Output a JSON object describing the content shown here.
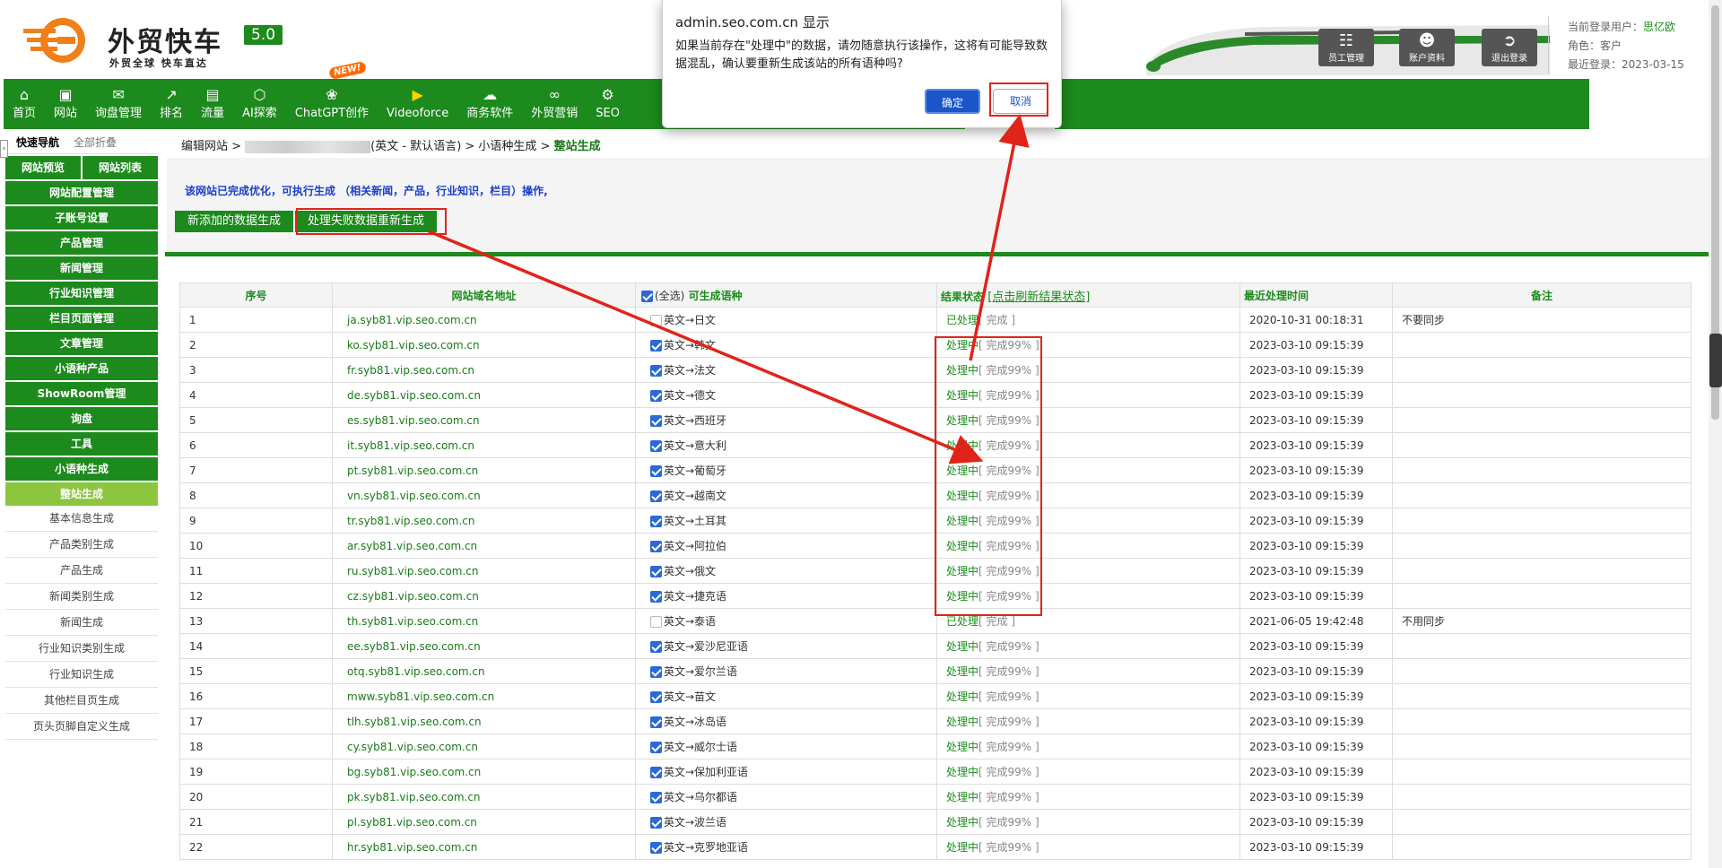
{
  "logo": {
    "name": "外贸快车",
    "version": "5.0",
    "slogan": "外贸全球 快车直达"
  },
  "header_buttons": [
    {
      "icon": "staff-icon",
      "label": "员工管理"
    },
    {
      "icon": "account-icon",
      "label": "账户资料"
    },
    {
      "icon": "logout-icon",
      "label": "退出登录"
    }
  ],
  "user_info": {
    "user_label": "当前登录用户：",
    "user": "思亿欧",
    "role_label": "角色：",
    "role": "客户",
    "last_login_label": "最近登录：",
    "last_login": "2023-03-15"
  },
  "nav": [
    {
      "icon": "home-icon",
      "label": "首页"
    },
    {
      "icon": "monitor-icon",
      "label": "网站"
    },
    {
      "icon": "mail-icon",
      "label": "询盘管理"
    },
    {
      "icon": "rank-icon",
      "label": "排名"
    },
    {
      "icon": "bar-chart-icon",
      "label": "流量"
    },
    {
      "icon": "ai-icon",
      "label": "AI探索"
    },
    {
      "icon": "chatgpt-icon",
      "label": "ChatGPT创作",
      "badge": "NEW!"
    },
    {
      "icon": "video-icon",
      "label": "Videoforce"
    },
    {
      "icon": "software-icon",
      "label": "商务软件"
    },
    {
      "icon": "marketing-icon",
      "label": "外贸营销"
    },
    {
      "icon": "seo-icon",
      "label": "SEO"
    }
  ],
  "sidebar": {
    "tab_quick": "快速导航",
    "tab_collapse": "全部折叠",
    "collapse_btn": "‹",
    "top_pair": [
      "网站预览",
      "网站列表"
    ],
    "groups": [
      "网站配置管理",
      "子账号设置",
      "产品管理",
      "新闻管理",
      "行业知识管理",
      "栏目页面管理",
      "文章管理",
      "小语种产品",
      "ShowRoom管理",
      "询盘",
      "工具",
      "小语种生成",
      "整站生成"
    ],
    "subitems": [
      "基本信息生成",
      "产品类别生成",
      "产品生成",
      "新闻类别生成",
      "新闻生成",
      "行业知识类别生成",
      "行业知识生成",
      "其他栏目页生成",
      "页头页脚自定义生成"
    ]
  },
  "breadcrumb": {
    "prefix": "编辑网站 >",
    "middle": "(英文 - 默认语言) > 小语种生成 >",
    "current": "整站生成"
  },
  "notice": "该网站已完成优化，可执行生成 （相关新闻，产品，行业知识，栏目）操作,",
  "gen_tabs": [
    "新添加的数据生成",
    "处理失败数据重新生成"
  ],
  "table": {
    "headers": {
      "no": "序号",
      "domain": "网站域名地址",
      "langs_all": "(全选)",
      "langs": "可生成语种",
      "status": "结果状态",
      "refresh": "[点击刷新结果状态]",
      "time": "最近处理时间",
      "note": "备注"
    },
    "rows": [
      {
        "no": "1",
        "domain": "ja.syb81.vip.seo.com.cn",
        "checked": false,
        "lang": "英文→日文",
        "state": "已处理",
        "progress": "[ 完成 ]",
        "time": "2020-10-31 00:18:31",
        "note": "不要同步"
      },
      {
        "no": "2",
        "domain": "ko.syb81.vip.seo.com.cn",
        "checked": true,
        "lang": "英文→韩文",
        "state": "处理中",
        "progress": "[ 完成99% ]",
        "time": "2023-03-10 09:15:39",
        "note": ""
      },
      {
        "no": "3",
        "domain": "fr.syb81.vip.seo.com.cn",
        "checked": true,
        "lang": "英文→法文",
        "state": "处理中",
        "progress": "[ 完成99% ]",
        "time": "2023-03-10 09:15:39",
        "note": ""
      },
      {
        "no": "4",
        "domain": "de.syb81.vip.seo.com.cn",
        "checked": true,
        "lang": "英文→德文",
        "state": "处理中",
        "progress": "[ 完成99% ]",
        "time": "2023-03-10 09:15:39",
        "note": ""
      },
      {
        "no": "5",
        "domain": "es.syb81.vip.seo.com.cn",
        "checked": true,
        "lang": "英文→西班牙",
        "state": "处理中",
        "progress": "[ 完成99% ]",
        "time": "2023-03-10 09:15:39",
        "note": ""
      },
      {
        "no": "6",
        "domain": "it.syb81.vip.seo.com.cn",
        "checked": true,
        "lang": "英文→意大利",
        "state": "处理中",
        "progress": "[ 完成99% ]",
        "time": "2023-03-10 09:15:39",
        "note": ""
      },
      {
        "no": "7",
        "domain": "pt.syb81.vip.seo.com.cn",
        "checked": true,
        "lang": "英文→葡萄牙",
        "state": "处理中",
        "progress": "[ 完成99% ]",
        "time": "2023-03-10 09:15:39",
        "note": ""
      },
      {
        "no": "8",
        "domain": "vn.syb81.vip.seo.com.cn",
        "checked": true,
        "lang": "英文→越南文",
        "state": "处理中",
        "progress": "[ 完成99% ]",
        "time": "2023-03-10 09:15:39",
        "note": ""
      },
      {
        "no": "9",
        "domain": "tr.syb81.vip.seo.com.cn",
        "checked": true,
        "lang": "英文→土耳其",
        "state": "处理中",
        "progress": "[ 完成99% ]",
        "time": "2023-03-10 09:15:39",
        "note": ""
      },
      {
        "no": "10",
        "domain": "ar.syb81.vip.seo.com.cn",
        "checked": true,
        "lang": "英文→阿拉伯",
        "state": "处理中",
        "progress": "[ 完成99% ]",
        "time": "2023-03-10 09:15:39",
        "note": ""
      },
      {
        "no": "11",
        "domain": "ru.syb81.vip.seo.com.cn",
        "checked": true,
        "lang": "英文→俄文",
        "state": "处理中",
        "progress": "[ 完成99% ]",
        "time": "2023-03-10 09:15:39",
        "note": ""
      },
      {
        "no": "12",
        "domain": "cz.syb81.vip.seo.com.cn",
        "checked": true,
        "lang": "英文→捷克语",
        "state": "处理中",
        "progress": "[ 完成99% ]",
        "time": "2023-03-10 09:15:39",
        "note": ""
      },
      {
        "no": "13",
        "domain": "th.syb81.vip.seo.com.cn",
        "checked": false,
        "lang": "英文→泰语",
        "state": "已处理",
        "progress": "[ 完成 ]",
        "time": "2021-06-05 19:42:48",
        "note": "不用同步"
      },
      {
        "no": "14",
        "domain": "ee.syb81.vip.seo.com.cn",
        "checked": true,
        "lang": "英文→爱沙尼亚语",
        "state": "处理中",
        "progress": "[ 完成99% ]",
        "time": "2023-03-10 09:15:39",
        "note": ""
      },
      {
        "no": "15",
        "domain": "otq.syb81.vip.seo.com.cn",
        "checked": true,
        "lang": "英文→爱尔兰语",
        "state": "处理中",
        "progress": "[ 完成99% ]",
        "time": "2023-03-10 09:15:39",
        "note": ""
      },
      {
        "no": "16",
        "domain": "mww.syb81.vip.seo.com.cn",
        "checked": true,
        "lang": "英文→苗文",
        "state": "处理中",
        "progress": "[ 完成99% ]",
        "time": "2023-03-10 09:15:39",
        "note": ""
      },
      {
        "no": "17",
        "domain": "tlh.syb81.vip.seo.com.cn",
        "checked": true,
        "lang": "英文→冰岛语",
        "state": "处理中",
        "progress": "[ 完成99% ]",
        "time": "2023-03-10 09:15:39",
        "note": ""
      },
      {
        "no": "18",
        "domain": "cy.syb81.vip.seo.com.cn",
        "checked": true,
        "lang": "英文→威尔士语",
        "state": "处理中",
        "progress": "[ 完成99% ]",
        "time": "2023-03-10 09:15:39",
        "note": ""
      },
      {
        "no": "19",
        "domain": "bg.syb81.vip.seo.com.cn",
        "checked": true,
        "lang": "英文→保加利亚语",
        "state": "处理中",
        "progress": "[ 完成99% ]",
        "time": "2023-03-10 09:15:39",
        "note": ""
      },
      {
        "no": "20",
        "domain": "pk.syb81.vip.seo.com.cn",
        "checked": true,
        "lang": "英文→乌尔都语",
        "state": "处理中",
        "progress": "[ 完成99% ]",
        "time": "2023-03-10 09:15:39",
        "note": ""
      },
      {
        "no": "21",
        "domain": "pl.syb81.vip.seo.com.cn",
        "checked": true,
        "lang": "英文→波兰语",
        "state": "处理中",
        "progress": "[ 完成99% ]",
        "time": "2023-03-10 09:15:39",
        "note": ""
      },
      {
        "no": "22",
        "domain": "hr.syb81.vip.seo.com.cn",
        "checked": true,
        "lang": "英文→克罗地亚语",
        "state": "处理中",
        "progress": "[ 完成99% ]",
        "time": "2023-03-10 09:15:39",
        "note": ""
      }
    ]
  },
  "dialog": {
    "title": "admin.seo.com.cn 显示",
    "message": "如果当前存在\"处理中\"的数据，请勿随意执行该操作，这将有可能导致数据混乱，确认要重新生成该站的所有语种吗?",
    "ok": "确定",
    "cancel": "取消"
  },
  "colors": {
    "brand_green": "#1c8a1c",
    "active_green": "#8cc63f",
    "annotation_red": "#e0241a",
    "dialog_blue": "#1a56c8"
  }
}
